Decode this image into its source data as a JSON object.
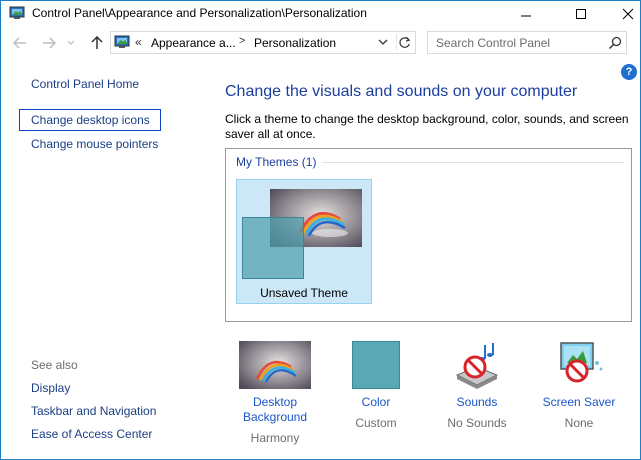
{
  "window": {
    "title": "Control Panel\\Appearance and Personalization\\Personalization"
  },
  "address": {
    "overflow": "«",
    "crumb1": "Appearance a...",
    "separator": ">",
    "crumb2": "Personalization"
  },
  "search": {
    "placeholder": "Search Control Panel"
  },
  "help": {
    "label": "?"
  },
  "left": {
    "home": "Control Panel Home",
    "desktop_icons": "Change desktop icons",
    "mouse_pointers": "Change mouse pointers",
    "see_also": "See also",
    "display": "Display",
    "taskbar": "Taskbar and Navigation",
    "ease": "Ease of Access Center"
  },
  "main": {
    "title": "Change the visuals and sounds on your computer",
    "description": "Click a theme to change the desktop background, color, sounds, and screen saver all at once.",
    "my_themes": "My Themes (1)",
    "theme_name": "Unsaved Theme"
  },
  "bottom": {
    "background": {
      "label": "Desktop Background",
      "value": "Harmony"
    },
    "color": {
      "label": "Color",
      "value": "Custom",
      "swatch": "#5aa8b4"
    },
    "sounds": {
      "label": "Sounds",
      "value": "No Sounds"
    },
    "screensaver": {
      "label": "Screen Saver",
      "value": "None"
    }
  },
  "colors": {
    "link": "#1a3e84",
    "heading": "#1b3e9d",
    "selection": "#cce8f7",
    "focus_border": "#0b46c5"
  }
}
